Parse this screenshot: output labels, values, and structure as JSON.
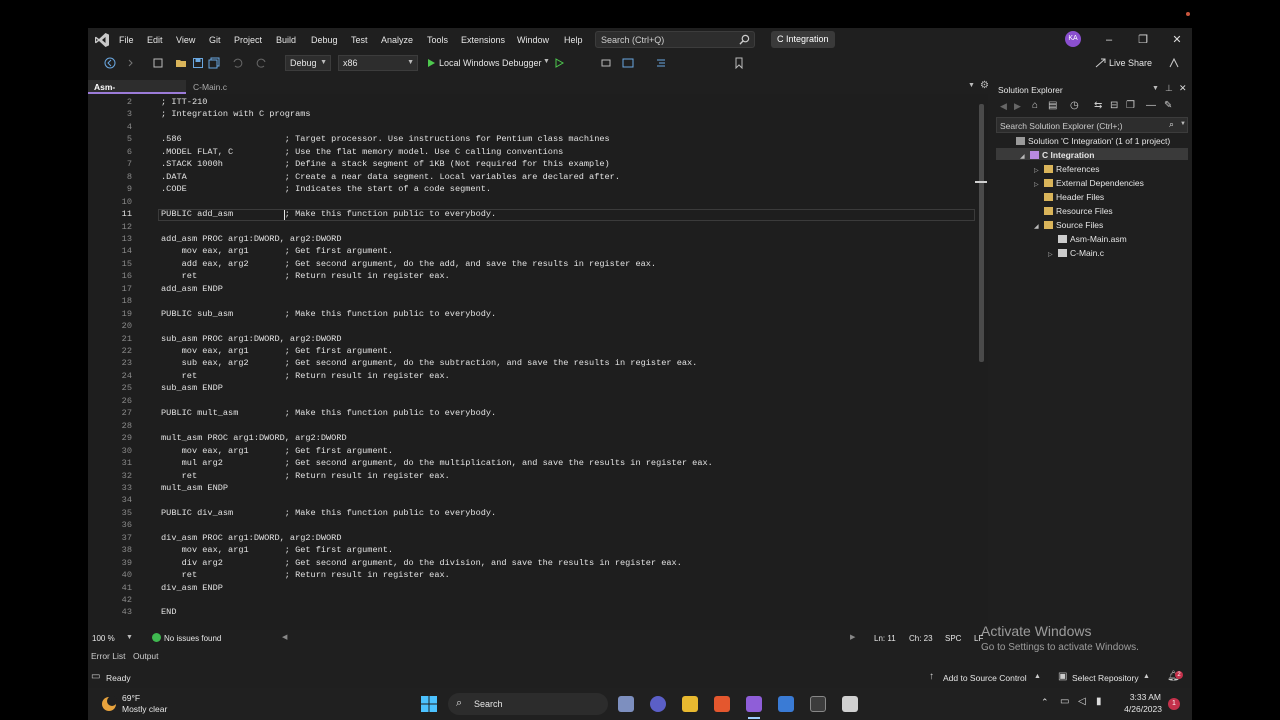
{
  "menu": [
    "File",
    "Edit",
    "View",
    "Git",
    "Project",
    "Build",
    "Debug",
    "Test",
    "Analyze",
    "Tools",
    "Extensions",
    "Window",
    "Help"
  ],
  "search": {
    "placeholder": "Search (Ctrl+Q)"
  },
  "solution_name": "C Integration",
  "user_initials": "KA",
  "toolbar": {
    "config": "Debug",
    "platform": "x86",
    "debugger": "Local Windows Debugger",
    "live_share": "Live Share"
  },
  "tabs": [
    {
      "label": "Asm-Main.asm",
      "active": true
    },
    {
      "label": "C-Main.c",
      "active": false
    }
  ],
  "editor": {
    "current_line": 11,
    "lines": [
      {
        "n": "2",
        "text": "; ITT-210"
      },
      {
        "n": "3",
        "text": "; Integration with C programs"
      },
      {
        "n": "4",
        "text": ""
      },
      {
        "n": "5",
        "text": ".586                    ; Target processor. Use instructions for Pentium class machines"
      },
      {
        "n": "6",
        "text": ".MODEL FLAT, C          ; Use the flat memory model. Use C calling conventions"
      },
      {
        "n": "7",
        "text": ".STACK 1000h            ; Define a stack segment of 1KB (Not required for this example)"
      },
      {
        "n": "8",
        "text": ".DATA                   ; Create a near data segment. Local variables are declared after."
      },
      {
        "n": "9",
        "text": ".CODE                   ; Indicates the start of a code segment."
      },
      {
        "n": "10",
        "text": ""
      },
      {
        "n": "11",
        "text": "PUBLIC add_asm          ; Make this function public to everybody."
      },
      {
        "n": "12",
        "text": ""
      },
      {
        "n": "13",
        "text": "add_asm PROC arg1:DWORD, arg2:DWORD"
      },
      {
        "n": "14",
        "text": "    mov eax, arg1       ; Get first argument."
      },
      {
        "n": "15",
        "text": "    add eax, arg2       ; Get second argument, do the add, and save the results in register eax."
      },
      {
        "n": "16",
        "text": "    ret                 ; Return result in register eax."
      },
      {
        "n": "17",
        "text": "add_asm ENDP"
      },
      {
        "n": "18",
        "text": ""
      },
      {
        "n": "19",
        "text": "PUBLIC sub_asm          ; Make this function public to everybody."
      },
      {
        "n": "20",
        "text": ""
      },
      {
        "n": "21",
        "text": "sub_asm PROC arg1:DWORD, arg2:DWORD"
      },
      {
        "n": "22",
        "text": "    mov eax, arg1       ; Get first argument."
      },
      {
        "n": "23",
        "text": "    sub eax, arg2       ; Get second argument, do the subtraction, and save the results in register eax."
      },
      {
        "n": "24",
        "text": "    ret                 ; Return result in register eax."
      },
      {
        "n": "25",
        "text": "sub_asm ENDP"
      },
      {
        "n": "26",
        "text": ""
      },
      {
        "n": "27",
        "text": "PUBLIC mult_asm         ; Make this function public to everybody."
      },
      {
        "n": "28",
        "text": ""
      },
      {
        "n": "29",
        "text": "mult_asm PROC arg1:DWORD, arg2:DWORD"
      },
      {
        "n": "30",
        "text": "    mov eax, arg1       ; Get first argument."
      },
      {
        "n": "31",
        "text": "    mul arg2            ; Get second argument, do the multiplication, and save the results in register eax."
      },
      {
        "n": "32",
        "text": "    ret                 ; Return result in register eax."
      },
      {
        "n": "33",
        "text": "mult_asm ENDP"
      },
      {
        "n": "34",
        "text": ""
      },
      {
        "n": "35",
        "text": "PUBLIC div_asm          ; Make this function public to everybody."
      },
      {
        "n": "36",
        "text": ""
      },
      {
        "n": "37",
        "text": "div_asm PROC arg1:DWORD, arg2:DWORD"
      },
      {
        "n": "38",
        "text": "    mov eax, arg1       ; Get first argument."
      },
      {
        "n": "39",
        "text": "    div arg2            ; Get second argument, do the division, and save the results in register eax."
      },
      {
        "n": "40",
        "text": "    ret                 ; Return result in register eax."
      },
      {
        "n": "41",
        "text": "div_asm ENDP"
      },
      {
        "n": "42",
        "text": ""
      },
      {
        "n": "43",
        "text": "END"
      }
    ]
  },
  "editor_status": {
    "zoom": "100 %",
    "issues": "No issues found",
    "ln": "Ln: 11",
    "ch": "Ch: 23",
    "spc": "SPC",
    "eol": "LF"
  },
  "solution_explorer": {
    "title": "Solution Explorer",
    "search_placeholder": "Search Solution Explorer (Ctrl+;)",
    "items": [
      {
        "label": "Solution 'C Integration' (1 of 1 project)",
        "level": 0,
        "arrow": ""
      },
      {
        "label": "C Integration",
        "level": 1,
        "arrow": "◢",
        "bold": true
      },
      {
        "label": "References",
        "level": 2,
        "arrow": "▷"
      },
      {
        "label": "External Dependencies",
        "level": 2,
        "arrow": "▷"
      },
      {
        "label": "Header Files",
        "level": 2,
        "arrow": ""
      },
      {
        "label": "Resource Files",
        "level": 2,
        "arrow": ""
      },
      {
        "label": "Source Files",
        "level": 2,
        "arrow": "◢"
      },
      {
        "label": "Asm-Main.asm",
        "level": 3,
        "arrow": ""
      },
      {
        "label": "C-Main.c",
        "level": 3,
        "arrow": "▷"
      }
    ]
  },
  "bottom_tabs": [
    "Error List",
    "Output"
  ],
  "status": {
    "ready": "Ready",
    "source_control": "Add to Source Control",
    "repo": "Select Repository",
    "notifications": "2"
  },
  "watermark": {
    "title": "Activate Windows",
    "sub": "Go to Settings to activate Windows."
  },
  "taskbar": {
    "temp": "69°F",
    "weather": "Mostly clear",
    "search": "Search",
    "time": "3:33 AM",
    "date": "4/26/2023",
    "notif": "1"
  }
}
